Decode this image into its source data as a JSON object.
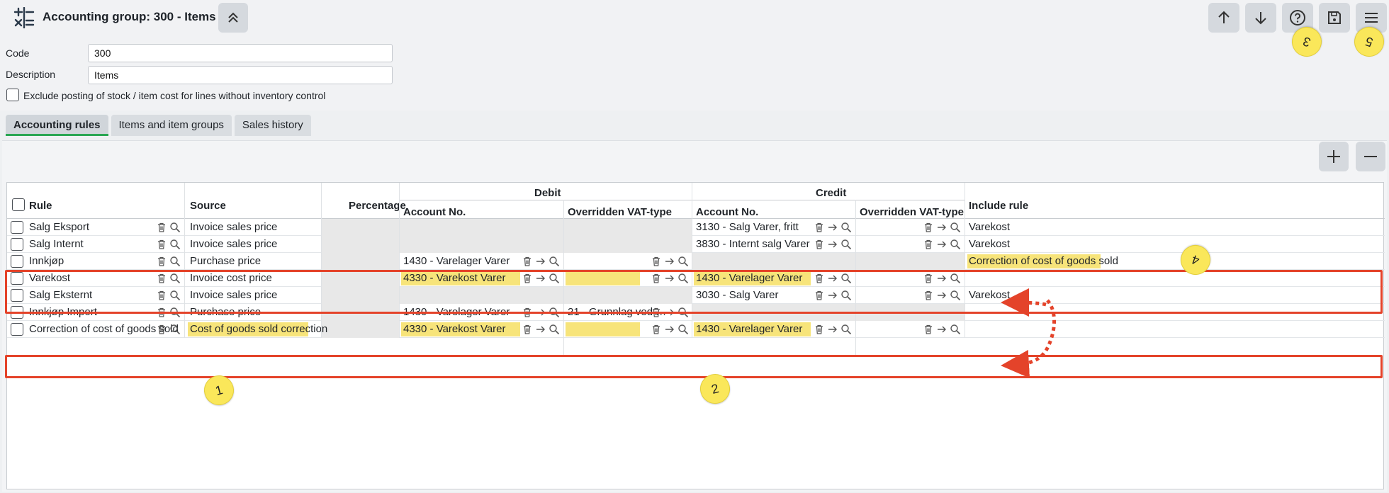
{
  "header": {
    "title": "Accounting group: 300 - Items",
    "collapse_icon": "chevron-double-up-icon",
    "toolbar_icons": [
      "arrow-up-icon",
      "arrow-down-icon",
      "help-icon",
      "save-icon",
      "menu-icon"
    ]
  },
  "form": {
    "code_label": "Code",
    "code_value": "300",
    "description_label": "Description",
    "description_value": "Items",
    "exclude_label": "Exclude posting of stock / item cost for lines without inventory control",
    "exclude_checked": false
  },
  "tabs": [
    {
      "label": "Accounting rules",
      "active": true
    },
    {
      "label": "Items and item groups",
      "active": false
    },
    {
      "label": "Sales history",
      "active": false
    }
  ],
  "grid": {
    "headers": {
      "rule": "Rule",
      "source": "Source",
      "percentage": "Percentage",
      "debit": "Debit",
      "credit": "Credit",
      "debit_account": "Account No.",
      "debit_vat": "Overridden VAT-type",
      "credit_account": "Account No.",
      "credit_vat": "Overridden VAT-type",
      "include_rule": "Include rule"
    },
    "rows": [
      {
        "rule": "Salg Eksport",
        "source": "Invoice sales price",
        "debit_account": "",
        "debit_vat": "",
        "credit_account": "3130 - Salg Varer, fritt",
        "credit_vat": "",
        "include_rule": "Varekost"
      },
      {
        "rule": "Salg Internt",
        "source": "Invoice sales price",
        "debit_account": "",
        "debit_vat": "",
        "credit_account": "3830 - Internt salg Varer",
        "credit_vat": "",
        "include_rule": "Varekost"
      },
      {
        "rule": "Innkjøp",
        "source": "Purchase price",
        "debit_account": "1430 - Varelager Varer",
        "debit_vat": "",
        "credit_account": "",
        "credit_vat": "",
        "include_rule": "Correction of cost of goods sold"
      },
      {
        "rule": "Varekost",
        "source": "Invoice cost price",
        "debit_account": "4330 - Varekost Varer",
        "debit_vat": "",
        "credit_account": "1430 - Varelager Varer",
        "credit_vat": "",
        "include_rule": ""
      },
      {
        "rule": "Salg Eksternt",
        "source": "Invoice sales price",
        "debit_account": "",
        "debit_vat": "",
        "credit_account": "3030 - Salg Varer",
        "credit_vat": "",
        "include_rule": "Varekost"
      },
      {
        "rule": "Innkjøp Import",
        "source": "Purchase price",
        "debit_account": "1430 - Varelager Varer",
        "debit_vat": "21 - Grunnlag ved …",
        "credit_account": "",
        "credit_vat": "",
        "include_rule": ""
      },
      {
        "rule": "Correction of cost of goods sold",
        "source": "Cost of goods sold correction",
        "debit_account": "4330 - Varekost Varer",
        "debit_vat": "",
        "credit_account": "1430 - Varelager Varer",
        "credit_vat": "",
        "include_rule": ""
      }
    ]
  },
  "callouts": [
    "1",
    "2",
    "3",
    "4",
    "5"
  ],
  "colors": {
    "highlight": "#f7e47a",
    "annotation_red": "#e4432a",
    "callout_yellow": "#fae75a",
    "active_tab_underline": "#2aa653"
  }
}
